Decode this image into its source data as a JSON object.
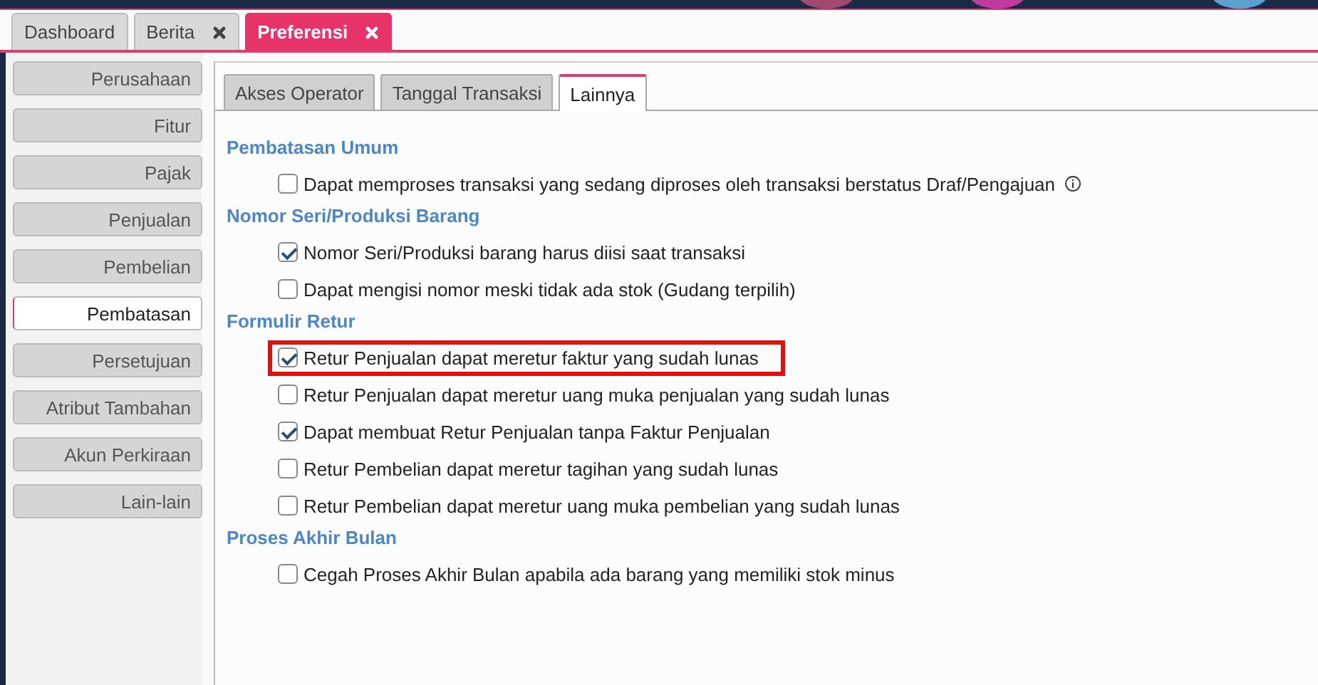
{
  "tabs": [
    {
      "label": "Dashboard",
      "selected": false,
      "closable": false
    },
    {
      "label": "Berita",
      "selected": false,
      "closable": true
    },
    {
      "label": "Preferensi",
      "selected": true,
      "closable": true
    }
  ],
  "sidebar": {
    "items": [
      {
        "label": "Perusahaan",
        "selected": false
      },
      {
        "label": "Fitur",
        "selected": false
      },
      {
        "label": "Pajak",
        "selected": false
      },
      {
        "label": "Penjualan",
        "selected": false
      },
      {
        "label": "Pembelian",
        "selected": false
      },
      {
        "label": "Pembatasan",
        "selected": true
      },
      {
        "label": "Persetujuan",
        "selected": false
      },
      {
        "label": "Atribut Tambahan",
        "selected": false
      },
      {
        "label": "Akun Perkiraan",
        "selected": false
      },
      {
        "label": "Lain-lain",
        "selected": false
      }
    ]
  },
  "subtabs": [
    {
      "label": "Akses Operator",
      "selected": false
    },
    {
      "label": "Tanggal Transaksi",
      "selected": false
    },
    {
      "label": "Lainnya",
      "selected": true
    }
  ],
  "sections": [
    {
      "title": "Pembatasan Umum",
      "items": [
        {
          "label": "Dapat memproses transaksi yang sedang diproses oleh transaksi berstatus Draf/Pengajuan",
          "checked": false,
          "info": true,
          "highlighted": false
        }
      ]
    },
    {
      "title": "Nomor Seri/Produksi Barang",
      "items": [
        {
          "label": "Nomor Seri/Produksi barang harus diisi saat transaksi",
          "checked": true,
          "info": false,
          "highlighted": false
        },
        {
          "label": "Dapat mengisi nomor meski tidak ada stok (Gudang terpilih)",
          "checked": false,
          "info": false,
          "highlighted": false
        }
      ]
    },
    {
      "title": "Formulir Retur",
      "items": [
        {
          "label": "Retur Penjualan dapat meretur faktur yang sudah lunas",
          "checked": true,
          "info": false,
          "highlighted": true
        },
        {
          "label": "Retur Penjualan dapat meretur uang muka penjualan yang sudah lunas",
          "checked": false,
          "info": false,
          "highlighted": false
        },
        {
          "label": "Dapat membuat Retur Penjualan tanpa Faktur Penjualan",
          "checked": true,
          "info": false,
          "highlighted": false
        },
        {
          "label": "Retur Pembelian dapat meretur tagihan yang sudah lunas",
          "checked": false,
          "info": false,
          "highlighted": false
        },
        {
          "label": "Retur Pembelian dapat meretur uang muka pembelian yang sudah lunas",
          "checked": false,
          "info": false,
          "highlighted": false
        }
      ]
    },
    {
      "title": "Proses Akhir Bulan",
      "items": [
        {
          "label": "Cegah Proses Akhir Bulan apabila ada barang yang memiliki stok minus",
          "checked": false,
          "info": false,
          "highlighted": false
        }
      ]
    }
  ]
}
